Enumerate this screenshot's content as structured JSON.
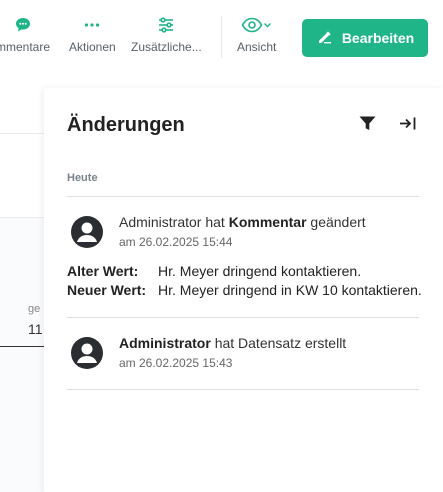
{
  "toolbar": {
    "items": [
      {
        "label": "mmentare",
        "icon": "comment-icon"
      },
      {
        "label": "Aktionen",
        "icon": "more-horizontal-icon"
      },
      {
        "label": "Zusätzliche...",
        "icon": "sliders-icon"
      },
      {
        "label": "Ansicht",
        "icon": "eye-icon"
      }
    ],
    "edit_label": "Bearbeiten",
    "accent": "#1fb589"
  },
  "background": {
    "field_label": "ge",
    "field_value": "11"
  },
  "panel": {
    "title": "Änderungen",
    "group_heading": "Heute",
    "entries": [
      {
        "user": "Administrator",
        "verb": "hat",
        "field": "Kommentar",
        "action": "geändert",
        "time": "am 26.02.2025 15:44",
        "old_label": "Alter Wert:",
        "old_value": "Hr. Meyer dringend kontaktieren.",
        "new_label": "Neuer Wert:",
        "new_value": "Hr. Meyer dringend in KW 10 kontaktieren."
      },
      {
        "user": "Administrator",
        "action": "hat Datensatz erstellt",
        "time": "am 26.02.2025 15:43"
      }
    ]
  }
}
